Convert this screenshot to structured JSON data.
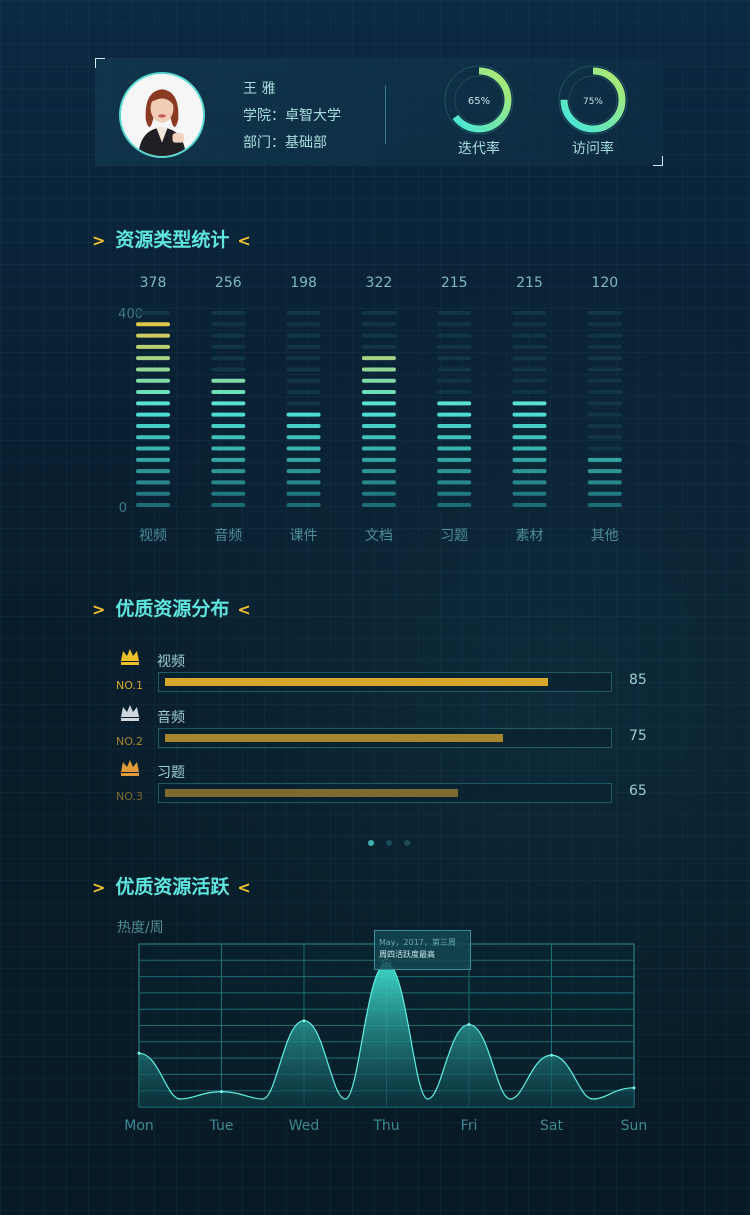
{
  "profile": {
    "name": "王 雅",
    "college": "学院：卓智大学",
    "department": "部门：基础部",
    "rings": [
      {
        "percent_label": "65%",
        "value": 0.65,
        "label": "迭代率"
      },
      {
        "percent_label": "75%",
        "value": 0.75,
        "label": "访问率"
      }
    ]
  },
  "sections": {
    "resource_types": "资源类型统计",
    "quality_distribution": "优质资源分布",
    "quality_activity": "优质资源活跃",
    "arrow_left": ">",
    "arrow_right": "<"
  },
  "chart_data": [
    {
      "type": "bar",
      "categories": [
        "视频",
        "音频",
        "课件",
        "文档",
        "习题",
        "素材",
        "其他"
      ],
      "values": [
        378,
        256,
        198,
        322,
        215,
        215,
        120
      ],
      "ylim": [
        0,
        400
      ],
      "yticks": [
        "0",
        "400"
      ],
      "colors": {
        "low": "#1d6b73",
        "mid": "#4fe4d6",
        "high": "#f2c33a"
      }
    },
    {
      "type": "area",
      "title": "",
      "ylabel": "热度/周",
      "categories": [
        "Mon",
        "Tue",
        "Wed",
        "Thu",
        "Fri",
        "Sat",
        "Sun"
      ],
      "values": [
        28,
        8,
        45,
        75,
        43,
        27,
        10
      ],
      "tooltip": {
        "line1": "May，2017，第三周",
        "line2": "周四活跃度最高"
      },
      "grid": true,
      "color": "#3fe0cf"
    }
  ],
  "ranking": {
    "items": [
      {
        "rank": "NO.1",
        "name": "视频",
        "score": "85",
        "value": 85,
        "color": "#d7a72c",
        "crown_color": "#f0c02a"
      },
      {
        "rank": "NO.2",
        "name": "音频",
        "score": "75",
        "value": 75,
        "color": "#a5852e",
        "crown_color": "#cfd6dc"
      },
      {
        "rank": "NO.3",
        "name": "习题",
        "score": "65",
        "value": 65,
        "color": "#7d6a2f",
        "crown_color": "#e09a3a"
      }
    ]
  }
}
